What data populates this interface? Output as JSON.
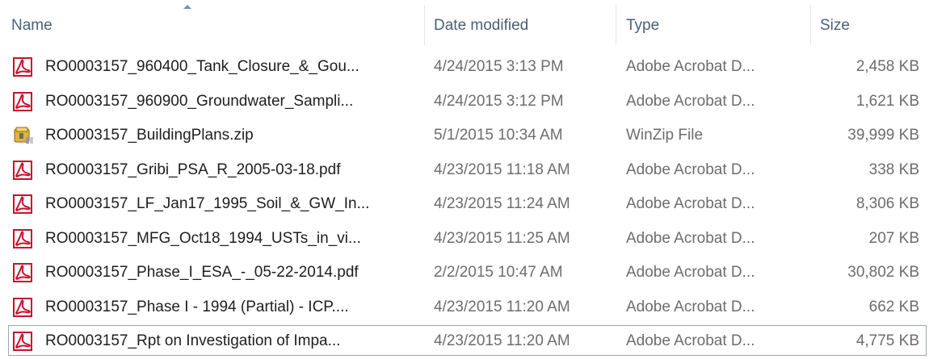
{
  "columns": {
    "name": "Name",
    "date": "Date modified",
    "type": "Type",
    "size": "Size"
  },
  "sort": {
    "column": "name",
    "direction": "ascending"
  },
  "files": [
    {
      "name": "RO0003157_960400_Tank_Closure_&_Gou...",
      "date": "4/24/2015 3:13 PM",
      "type": "Adobe Acrobat D...",
      "size": "2,458 KB",
      "icon": "pdf-icon"
    },
    {
      "name": "RO0003157_960900_Groundwater_Sampli...",
      "date": "4/24/2015 3:12 PM",
      "type": "Adobe Acrobat D...",
      "size": "1,621 KB",
      "icon": "pdf-icon"
    },
    {
      "name": "RO0003157_BuildingPlans.zip",
      "date": "5/1/2015 10:34 AM",
      "type": "WinZip File",
      "size": "39,999 KB",
      "icon": "zip-icon"
    },
    {
      "name": "RO0003157_Gribi_PSA_R_2005-03-18.pdf",
      "date": "4/23/2015 11:18 AM",
      "type": "Adobe Acrobat D...",
      "size": "338 KB",
      "icon": "pdf-icon"
    },
    {
      "name": "RO0003157_LF_Jan17_1995_Soil_&_GW_In...",
      "date": "4/23/2015 11:24 AM",
      "type": "Adobe Acrobat D...",
      "size": "8,306 KB",
      "icon": "pdf-icon"
    },
    {
      "name": "RO0003157_MFG_Oct18_1994_USTs_in_vi...",
      "date": "4/23/2015 11:25 AM",
      "type": "Adobe Acrobat D...",
      "size": "207 KB",
      "icon": "pdf-icon"
    },
    {
      "name": "RO0003157_Phase_I_ESA_-_05-22-2014.pdf",
      "date": "2/2/2015 10:47 AM",
      "type": "Adobe Acrobat D...",
      "size": "30,802 KB",
      "icon": "pdf-icon"
    },
    {
      "name": "RO0003157_Phase I - 1994 (Partial) - ICP....",
      "date": "4/23/2015 11:20 AM",
      "type": "Adobe Acrobat D...",
      "size": "662 KB",
      "icon": "pdf-icon"
    },
    {
      "name": "RO0003157_Rpt on Investigation of Impa...",
      "date": "4/23/2015 11:20 AM",
      "type": "Adobe Acrobat D...",
      "size": "4,775 KB",
      "icon": "pdf-icon",
      "focused": true
    }
  ],
  "colors": {
    "header_text": "#4c607a",
    "pdf_red": "#c8102e",
    "zip_yellow": "#e2b43a"
  }
}
